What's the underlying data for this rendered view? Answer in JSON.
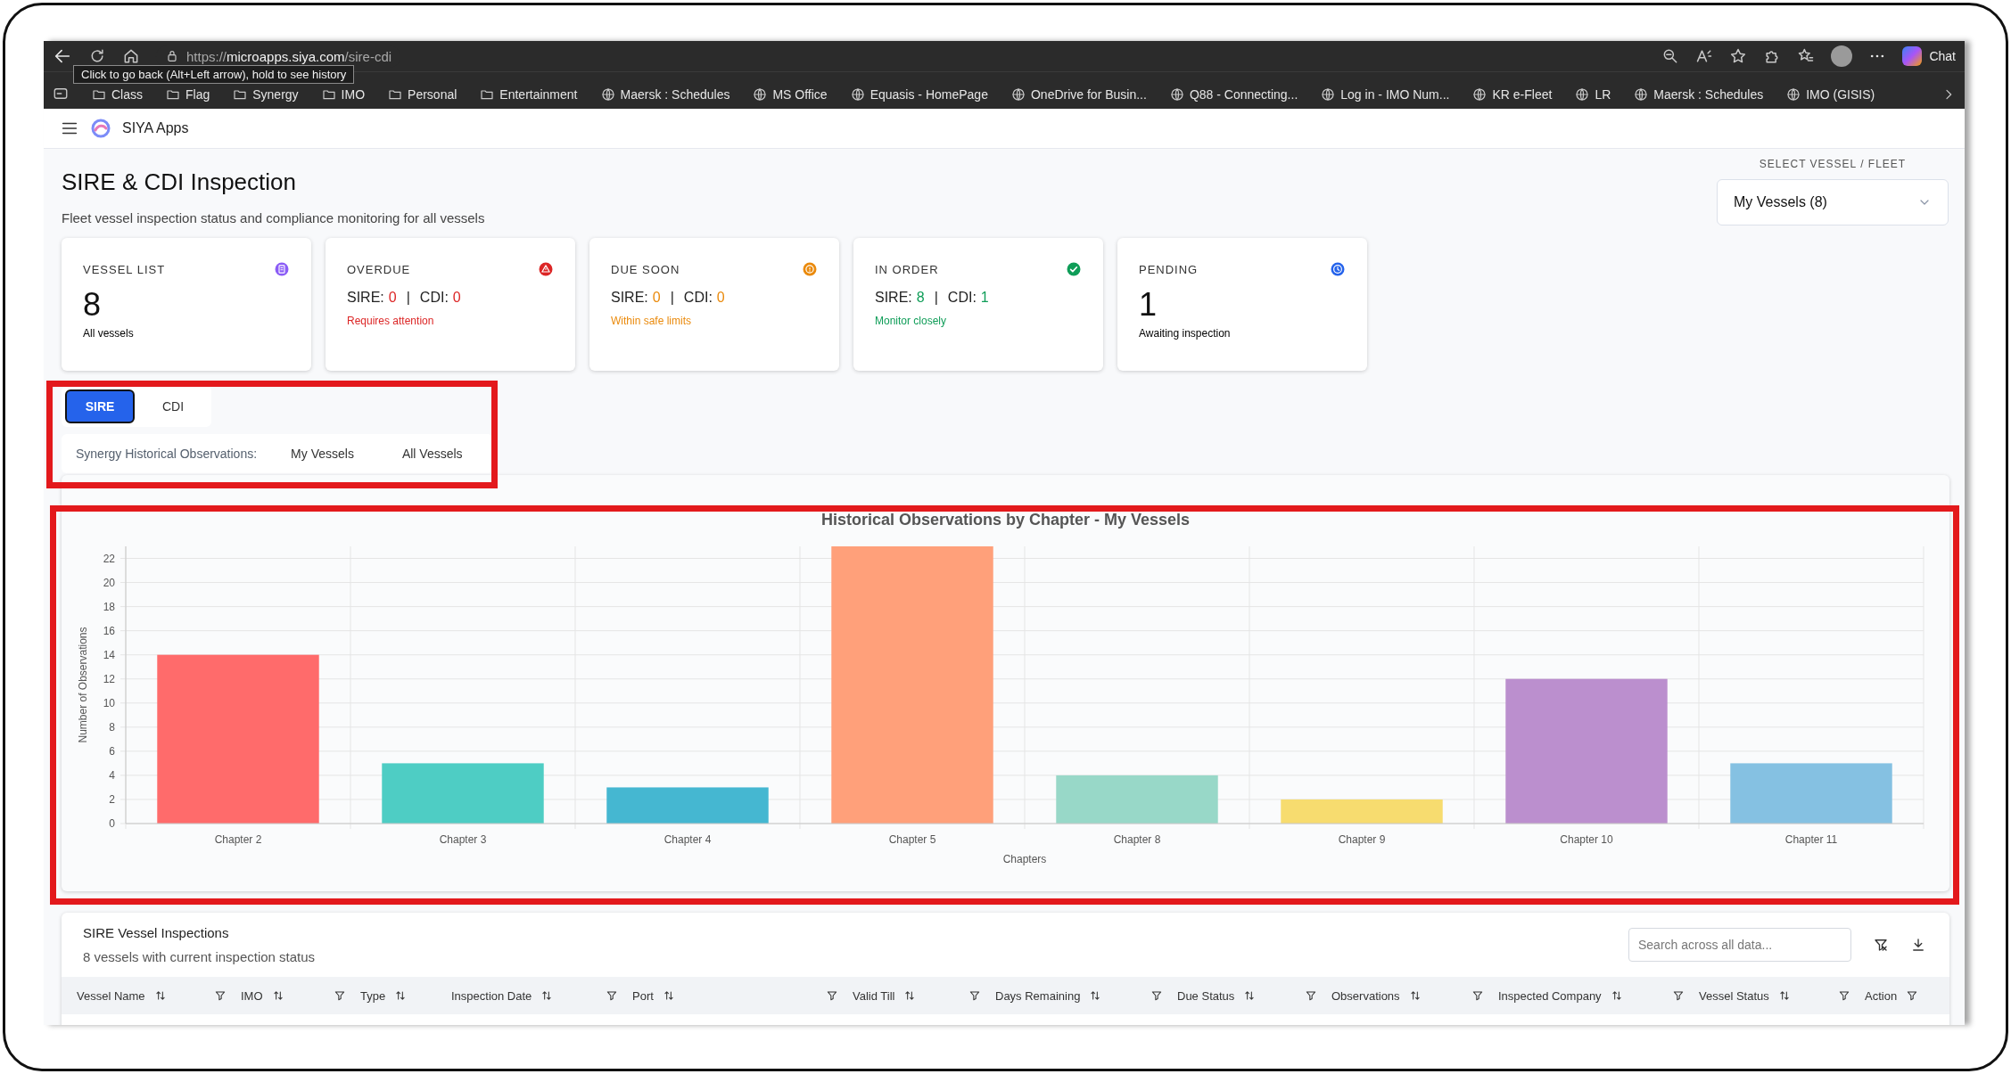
{
  "browser": {
    "url": "https://**microapps.siya.com**/sire-cdi",
    "tooltip": "Click to go back (Alt+Left arrow), hold to see history",
    "profile_label": "Chat",
    "bookmarks": [
      {
        "kind": "folder",
        "label": "Class"
      },
      {
        "kind": "folder",
        "label": "Flag"
      },
      {
        "kind": "folder",
        "label": "Synergy"
      },
      {
        "kind": "folder",
        "label": "IMO"
      },
      {
        "kind": "folder",
        "label": "Personal"
      },
      {
        "kind": "folder",
        "label": "Entertainment"
      },
      {
        "kind": "site",
        "label": "Maersk : Schedules"
      },
      {
        "kind": "site",
        "label": "MS Office"
      },
      {
        "kind": "site",
        "label": "Equasis - HomePage"
      },
      {
        "kind": "site",
        "label": "OneDrive for Busin..."
      },
      {
        "kind": "site",
        "label": "Q88 - Connecting..."
      },
      {
        "kind": "site",
        "label": "Log in - IMO Num..."
      },
      {
        "kind": "site",
        "label": "KR e-Fleet"
      },
      {
        "kind": "site",
        "label": "LR"
      },
      {
        "kind": "site",
        "label": "Maersk : Schedules"
      },
      {
        "kind": "site",
        "label": "IMO (GISIS)"
      }
    ]
  },
  "app": {
    "name": "SIYA Apps"
  },
  "page": {
    "title": "SIRE & CDI Inspection",
    "subtitle": "Fleet vessel inspection status and compliance monitoring for all vessels"
  },
  "vessel_select": {
    "label": "SELECT VESSEL / FLEET",
    "value": "My Vessels (8)"
  },
  "cards": [
    {
      "kind": "count",
      "label": "VESSEL LIST",
      "color": "#8b5cf6",
      "value": "8",
      "note": "All vessels"
    },
    {
      "kind": "split",
      "label": "OVERDUE",
      "color": "#dc2626",
      "sire_label": "SIRE:",
      "sire": "0",
      "separator": "|",
      "cdi_label": "CDI:",
      "cdi": "0",
      "note": "Requires attention"
    },
    {
      "kind": "split",
      "label": "DUE SOON",
      "color": "#ea8a0c",
      "sire_label": "SIRE:",
      "sire": "0",
      "separator": "|",
      "cdi_label": "CDI:",
      "cdi": "0",
      "note": "Within safe limits"
    },
    {
      "kind": "split",
      "label": "IN ORDER",
      "color": "#0f9d58",
      "sire_label": "SIRE:",
      "sire": "8",
      "separator": "|",
      "cdi_label": "CDI:",
      "cdi": "1",
      "note": "Monitor closely"
    },
    {
      "kind": "count",
      "label": "PENDING",
      "color": "#2563eb",
      "value": "1",
      "note": "Awaiting inspection"
    }
  ],
  "tabs": [
    {
      "label": "SIRE",
      "selected": true
    },
    {
      "label": "CDI",
      "selected": false
    }
  ],
  "observations_filter": {
    "label": "Synergy Historical Observations:",
    "options": [
      "My Vessels",
      "All Vessels"
    ]
  },
  "chart": {
    "chart_data": {
      "type": "bar",
      "title": "Historical Observations by Chapter - My Vessels",
      "xlabel": "Chapters",
      "ylabel": "Number of Observations",
      "categories": [
        "Chapter 2",
        "Chapter 3",
        "Chapter 4",
        "Chapter 5",
        "Chapter 8",
        "Chapter 9",
        "Chapter 10",
        "Chapter 11"
      ],
      "values": [
        14,
        5,
        3,
        23,
        4,
        2,
        12,
        5
      ],
      "ylim": [
        0,
        23
      ],
      "grid": true,
      "yticks": [
        0,
        2,
        4,
        6,
        8,
        10,
        12,
        14,
        16,
        18,
        20,
        22
      ]
    }
  },
  "table": {
    "title": "SIRE Vessel Inspections",
    "subtitle": "8 vessels with current inspection status",
    "search": {
      "placeholder": "Search across all data..."
    },
    "columns": [
      {
        "label": "Vessel Name",
        "sortable": true,
        "filterable": true
      },
      {
        "label": "IMO",
        "sortable": true,
        "filterable": true
      },
      {
        "label": "Type",
        "sortable": true,
        "filterable": false
      },
      {
        "label": "Inspection Date",
        "sortable": true,
        "filterable": true
      },
      {
        "label": "Port",
        "sortable": true,
        "filterable": true
      },
      {
        "label": "Valid Till",
        "sortable": true,
        "filterable": true
      },
      {
        "label": "Days Remaining",
        "sortable": true,
        "filterable": true
      },
      {
        "label": "Due Status",
        "sortable": true,
        "filterable": true
      },
      {
        "label": "Observations",
        "sortable": true,
        "filterable": true
      },
      {
        "label": "Inspected Company",
        "sortable": true,
        "filterable": true
      },
      {
        "label": "Vessel Status",
        "sortable": true,
        "filterable": true
      },
      {
        "label": "Action",
        "sortable": false,
        "filterable": true
      }
    ]
  }
}
